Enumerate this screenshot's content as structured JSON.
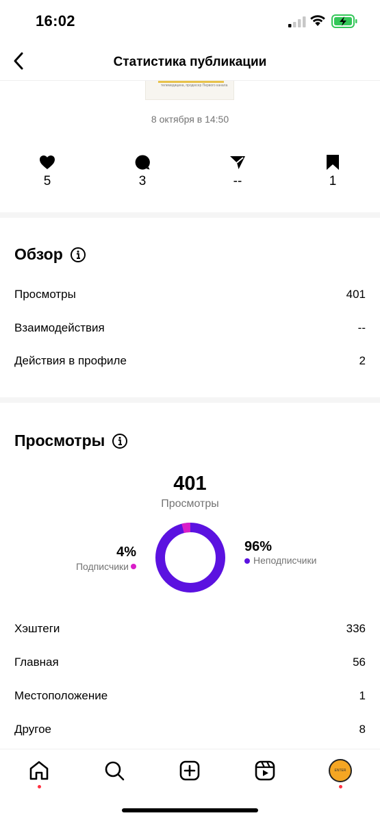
{
  "status_bar": {
    "time": "16:02"
  },
  "nav": {
    "title": "Статистика публикации"
  },
  "post": {
    "thumbnail_text": "телемедицина, продюсер Первого канала",
    "date": "8 октября в 14:50"
  },
  "metrics": {
    "likes": "5",
    "comments": "3",
    "shares": "--",
    "saves": "1"
  },
  "overview": {
    "title": "Обзор",
    "rows": [
      {
        "label": "Просмотры",
        "value": "401"
      },
      {
        "label": "Взаимодействия",
        "value": "--"
      },
      {
        "label": "Действия в профиле",
        "value": "2"
      }
    ]
  },
  "views": {
    "title": "Просмотры",
    "total": "401",
    "total_label": "Просмотры",
    "followers_pct": "4%",
    "followers_label": "Подписчики",
    "non_followers_pct": "96%",
    "non_followers_label": "Неподписчики",
    "followers_fraction": 0.04,
    "colors": {
      "followers": "#d91ec8",
      "non_followers": "#5b12e0"
    },
    "sources": [
      {
        "label": "Хэштеги",
        "value": "336"
      },
      {
        "label": "Главная",
        "value": "56"
      },
      {
        "label": "Местоположение",
        "value": "1"
      },
      {
        "label": "Другое",
        "value": "8"
      }
    ]
  },
  "tab_bar": {
    "avatar_text": "ENTER"
  }
}
